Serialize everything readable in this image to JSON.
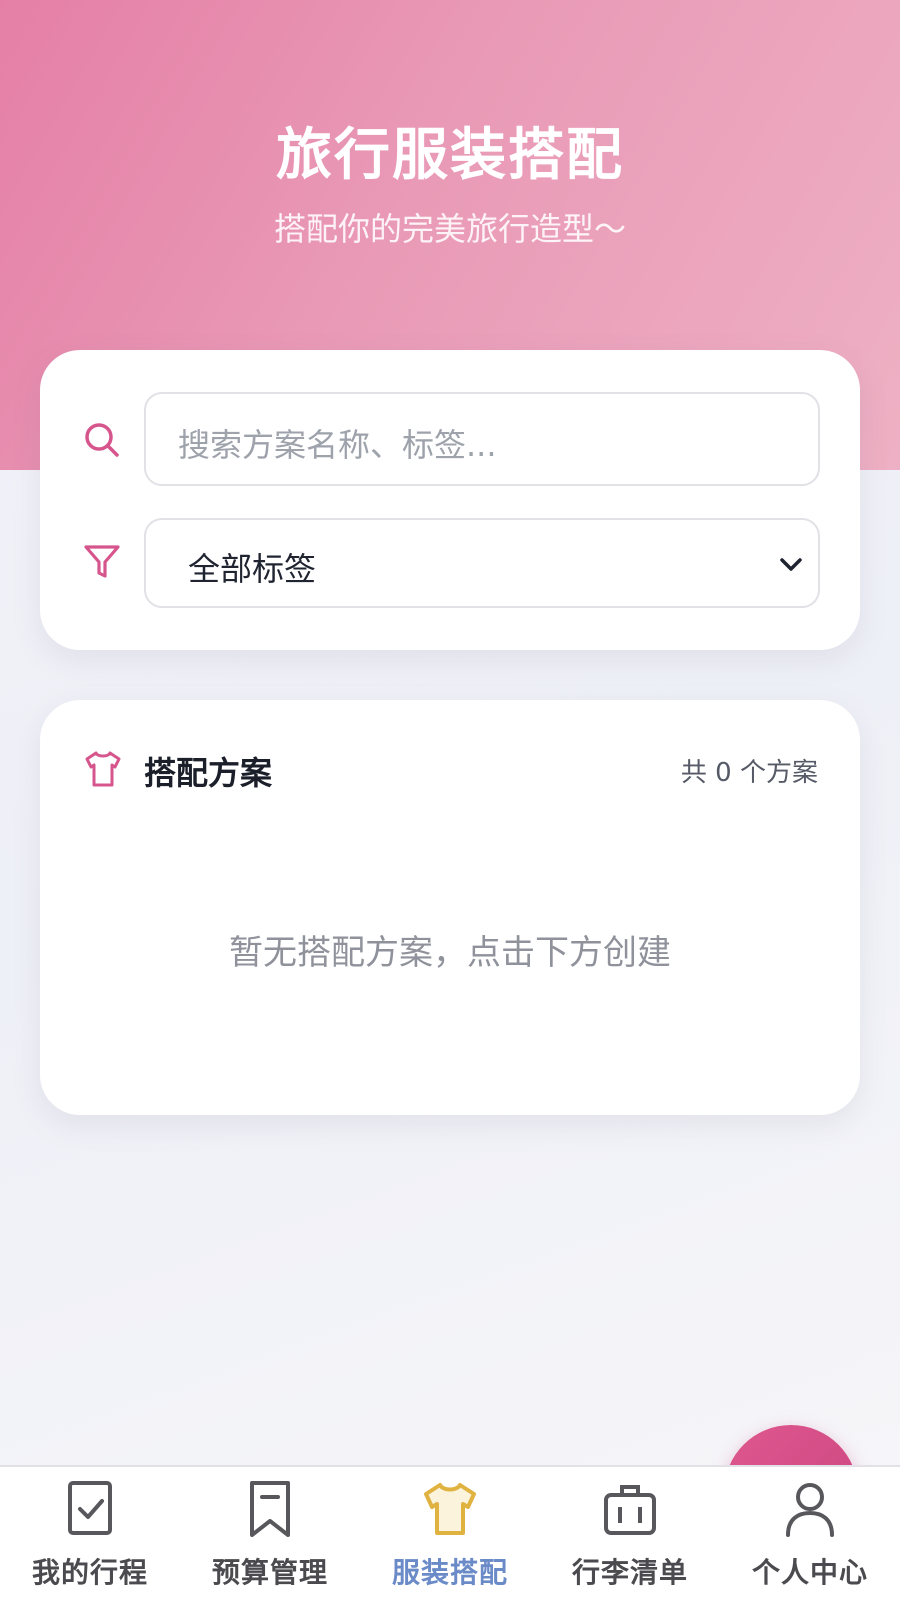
{
  "header": {
    "title": "旅行服装搭配",
    "subtitle": "搭配你的完美旅行造型～"
  },
  "search": {
    "icon": "search-icon",
    "placeholder": "搜索方案名称、标签..."
  },
  "filter": {
    "icon": "filter-icon",
    "selected": "全部标签"
  },
  "plans": {
    "icon": "shirt-icon",
    "title": "搭配方案",
    "count": "共 0 个方案",
    "empty": "暂无搭配方案，点击下方创建"
  },
  "colors": {
    "accent": "#d7558d",
    "hero_start": "#e57fa6",
    "hero_end": "#eeb0c4",
    "active_tab": "#6a8bc8",
    "active_icon": "#e0b240"
  },
  "tabbar": {
    "items": [
      {
        "label": "我的行程",
        "icon": "checklist-icon",
        "active": false
      },
      {
        "label": "预算管理",
        "icon": "bookmark-icon",
        "active": false
      },
      {
        "label": "服装搭配",
        "icon": "shirt-icon",
        "active": true
      },
      {
        "label": "行李清单",
        "icon": "suitcase-icon",
        "active": false
      },
      {
        "label": "个人中心",
        "icon": "user-icon",
        "active": false
      }
    ]
  }
}
